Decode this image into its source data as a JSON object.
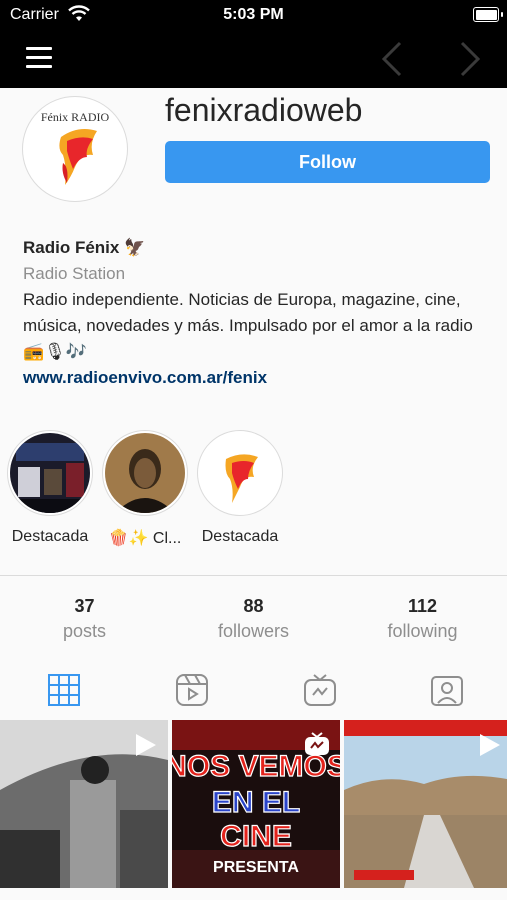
{
  "status_bar": {
    "carrier": "Carrier",
    "time": "5:03 PM"
  },
  "profile": {
    "username": "fenixradioweb",
    "follow_label": "Follow",
    "avatar_logo_text": "Fénix RADIO",
    "bio": {
      "name": "Radio Fénix 🦅",
      "category": "Radio Station",
      "description": "Radio independiente. Noticias de Europa, magazine, cine, música, novedades y más. Impulsado por el amor a la radio 📻🎙🎶",
      "link": "www.radioenvivo.com.ar/fenix"
    }
  },
  "highlights": [
    {
      "label": "Destacada",
      "icon": "highlight-photo-collage"
    },
    {
      "label": "🍿✨ Cl...",
      "icon": "highlight-godfather-portrait"
    },
    {
      "label": "Destacada",
      "icon": "highlight-fenix-logo"
    }
  ],
  "stats": {
    "posts": {
      "count": "37",
      "label": "posts"
    },
    "followers": {
      "count": "88",
      "label": "followers"
    },
    "following": {
      "count": "112",
      "label": "following"
    }
  },
  "tabs": [
    {
      "name": "grid-tab",
      "icon": "grid-icon",
      "active": true
    },
    {
      "name": "reels-tab",
      "icon": "reels-icon",
      "active": false
    },
    {
      "name": "igtv-tab",
      "icon": "igtv-icon",
      "active": false
    },
    {
      "name": "tagged-tab",
      "icon": "tagged-user-icon",
      "active": false
    }
  ],
  "posts": [
    {
      "type": "video",
      "badge": "play-icon"
    },
    {
      "type": "igtv",
      "badge": "igtv-icon",
      "overlay_text": "NOS VEMOS EN EL CINE PRESENTA"
    },
    {
      "type": "video",
      "badge": "play-icon"
    }
  ],
  "colors": {
    "accent": "#3897f0",
    "link": "#003569",
    "muted": "#8e8e8e",
    "bar": "#000000"
  }
}
